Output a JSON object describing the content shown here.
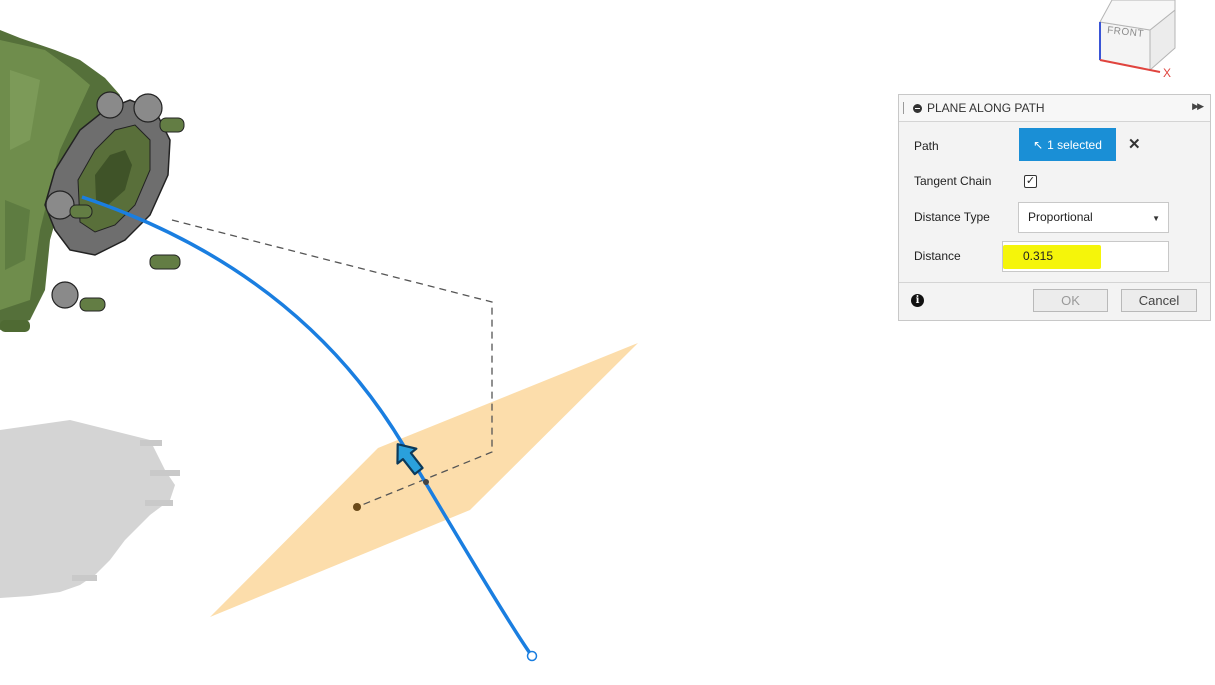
{
  "viewcube": {
    "face_label": "FRONT",
    "axis_label": "X"
  },
  "dialog": {
    "title": "PLANE ALONG PATH",
    "path": {
      "label": "Path",
      "button_label": "1 selected"
    },
    "tangent_chain": {
      "label": "Tangent Chain",
      "checked": true
    },
    "distance_type": {
      "label": "Distance Type",
      "value": "Proportional"
    },
    "distance": {
      "label": "Distance",
      "value": "0.315"
    },
    "ok_label": "OK",
    "cancel_label": "Cancel"
  },
  "colors": {
    "path_curve": "#1a7ee0",
    "plane_fill": "#fcd9a2",
    "selection_button": "#1a8fd6",
    "value_highlight": "#f5f50a"
  },
  "icons": [
    "minimize-icon",
    "expand-icon",
    "cursor-icon",
    "clear-icon",
    "checkbox-check-icon",
    "dropdown-arrow-icon",
    "info-icon",
    "drag-arrow-icon"
  ]
}
